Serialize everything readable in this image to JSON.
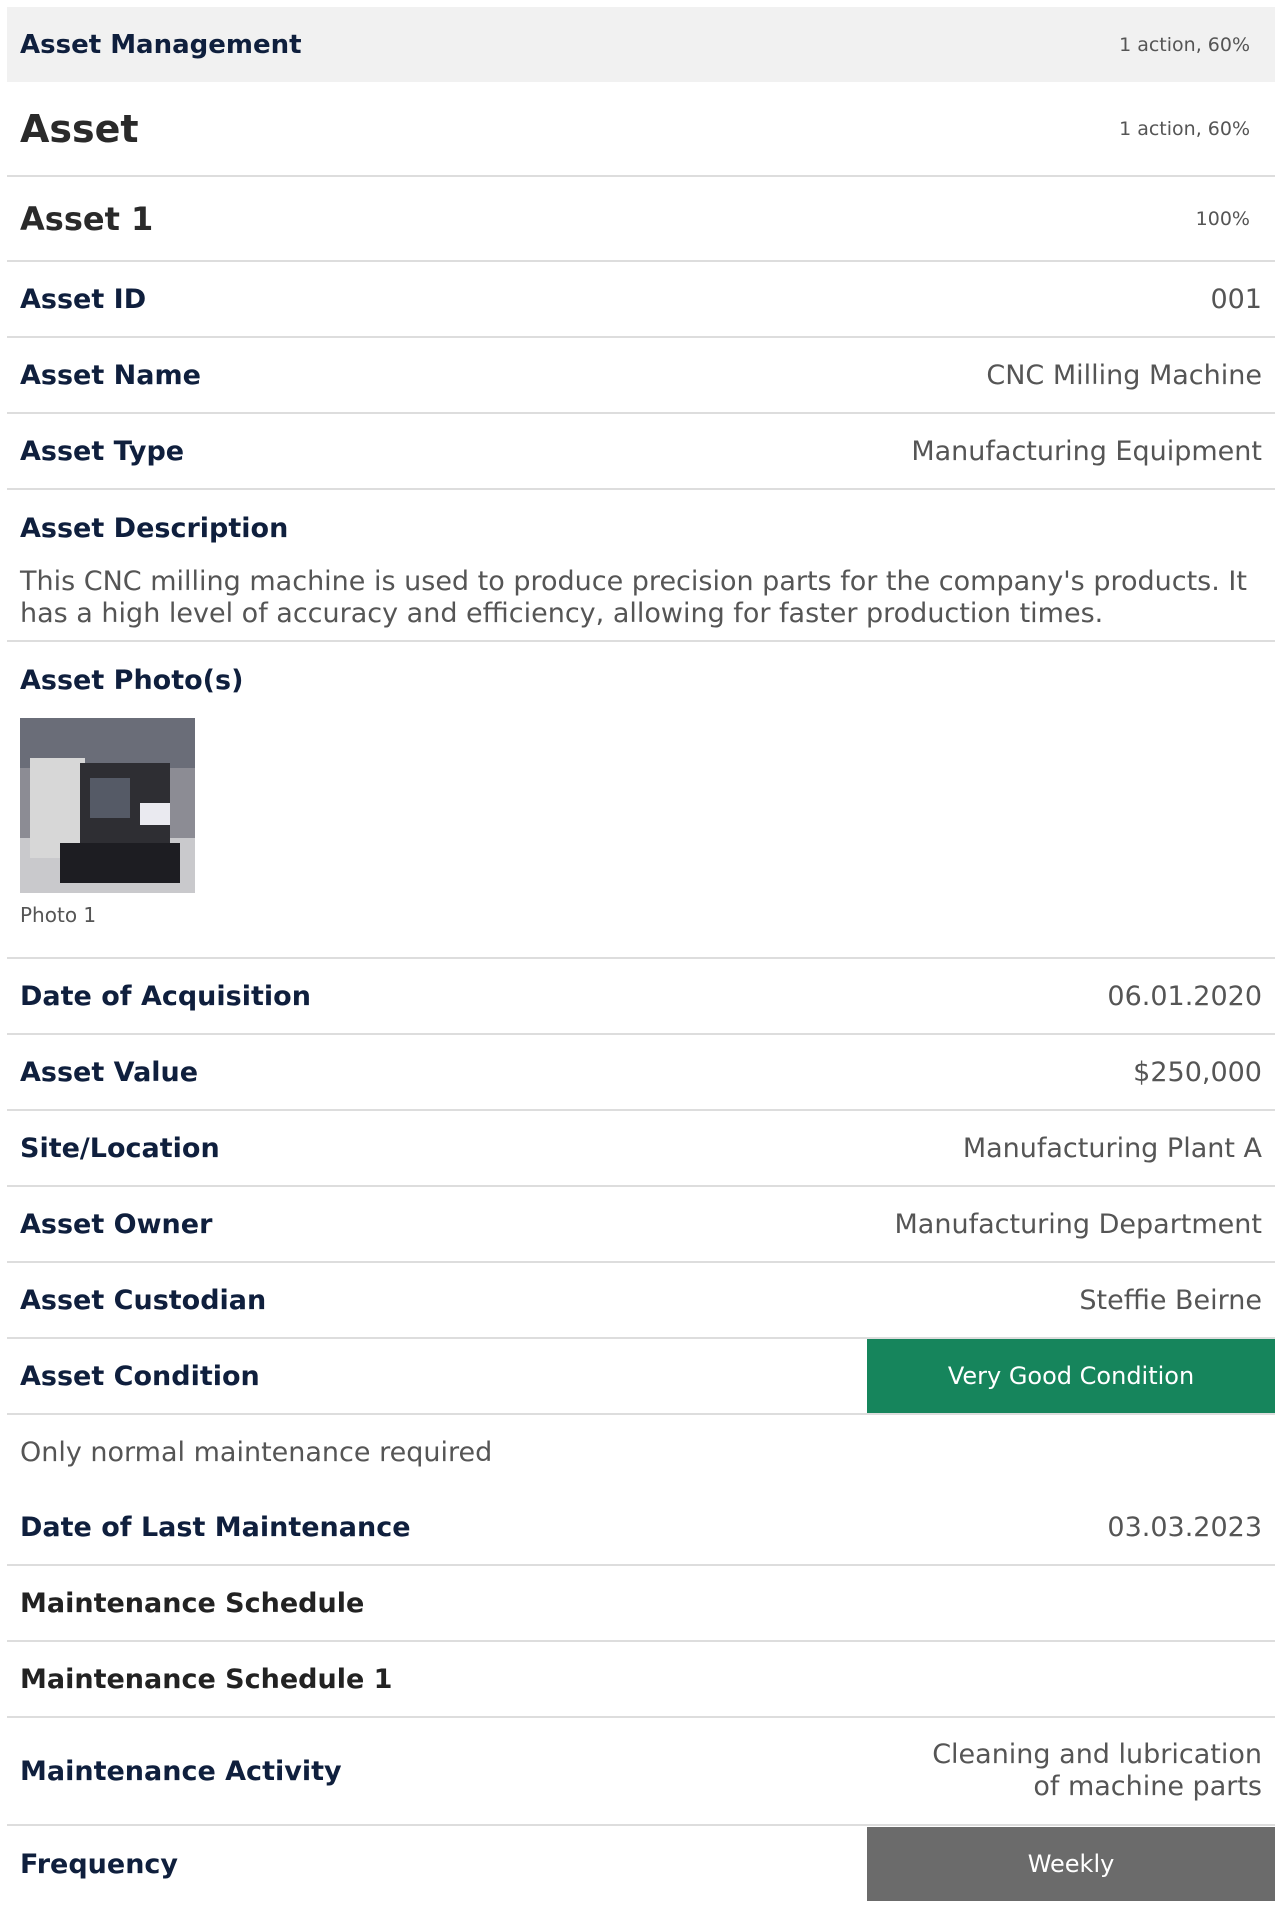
{
  "header": {
    "title": "Asset Management",
    "meta": "1 action, 60%"
  },
  "section": {
    "title": "Asset",
    "meta": "1 action, 60%"
  },
  "subsection": {
    "title": "Asset 1",
    "meta": "100%"
  },
  "fields": {
    "asset_id": {
      "label": "Asset ID",
      "value": "001"
    },
    "asset_name": {
      "label": "Asset Name",
      "value": "CNC Milling Machine"
    },
    "asset_type": {
      "label": "Asset Type",
      "value": "Manufacturing Equipment"
    },
    "asset_description": {
      "label": "Asset Description",
      "value": "This CNC milling machine is used to produce precision parts for the company's products. It has a high level of accuracy and efficiency, allowing for faster production times."
    },
    "asset_photos": {
      "label": "Asset Photo(s)",
      "caption": "Photo 1"
    },
    "date_of_acquisition": {
      "label": "Date of Acquisition",
      "value": "06.01.2020"
    },
    "asset_value": {
      "label": "Asset Value",
      "value": "$250,000"
    },
    "site_location": {
      "label": "Site/Location",
      "value": "Manufacturing Plant A"
    },
    "asset_owner": {
      "label": "Asset Owner",
      "value": "Manufacturing Department"
    },
    "asset_custodian": {
      "label": "Asset Custodian",
      "value": "Steffie Beirne"
    },
    "asset_condition": {
      "label": "Asset Condition",
      "value": "Very Good Condition",
      "color": "#16855c",
      "note": "Only normal maintenance required"
    },
    "date_last_maintenance": {
      "label": "Date of Last Maintenance",
      "value": "03.03.2023"
    },
    "maintenance_schedule": {
      "label": "Maintenance Schedule"
    },
    "maintenance_schedule_1": {
      "label": "Maintenance Schedule 1"
    },
    "maintenance_activity": {
      "label": "Maintenance Activity",
      "value": "Cleaning and lubrication of machine parts"
    },
    "frequency": {
      "label": "Frequency",
      "value": "Weekly",
      "color": "#6b6b6b"
    }
  }
}
